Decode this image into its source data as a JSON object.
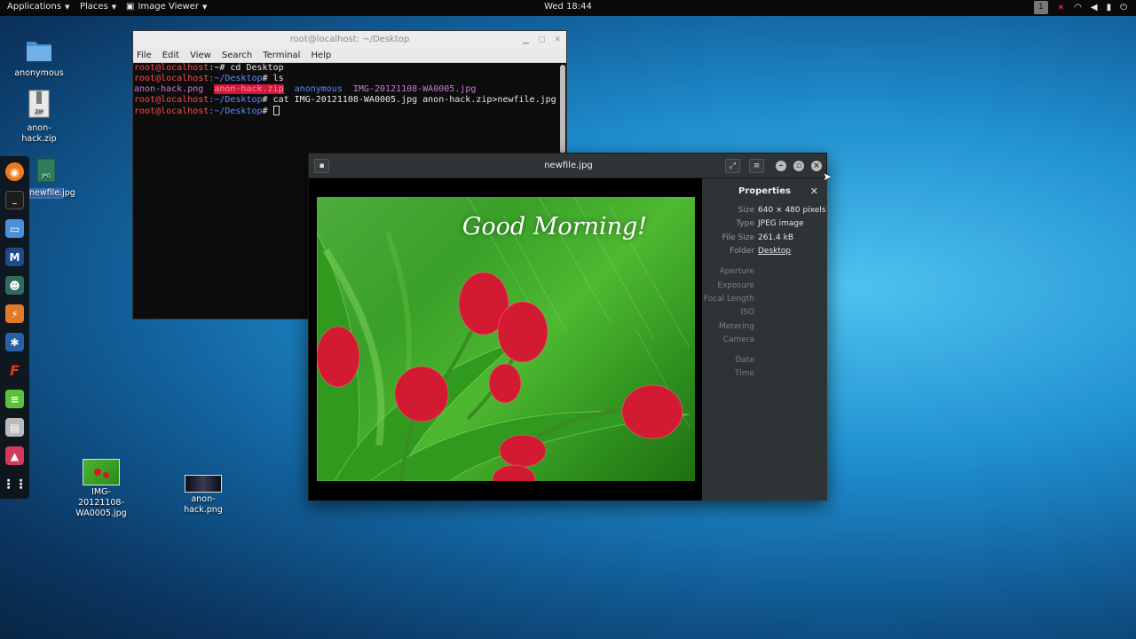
{
  "topbar": {
    "applications": "Applications",
    "places": "Places",
    "image_viewer": "Image Viewer",
    "clock": "Wed 18:44",
    "workspace": "1"
  },
  "desktop": {
    "icons": [
      {
        "label": "anonymous",
        "type": "folder"
      },
      {
        "label": "anon-hack.zip",
        "type": "zip"
      },
      {
        "label": "newfile.jpg",
        "type": "jpg"
      },
      {
        "label": "IMG-20121108-WA0005.jpg",
        "type": "image"
      },
      {
        "label": "anon-hack.png",
        "type": "image"
      }
    ],
    "zip_badge": "ZIP",
    "jpg_badge": "JPG"
  },
  "terminal": {
    "title": "root@localhost: ~/Desktop",
    "menu": [
      "File",
      "Edit",
      "View",
      "Search",
      "Terminal",
      "Help"
    ],
    "prompt_user": "root@localhost",
    "prompt_home": ":~#",
    "prompt_desktop_path": ":~/Desktop",
    "prompt_symbol": "#",
    "cmd1": " cd Desktop",
    "cmd2": " ls",
    "ls_items": [
      "anon-hack.png",
      "anon-hack.zip",
      "anonymous",
      "IMG-20121108-WA0005.jpg"
    ],
    "cmd3": " cat IMG-20121108-WA0005.jpg anon-hack.zip>newfile.jpg"
  },
  "viewer": {
    "title": "newfile.jpg",
    "caption": "Good Morning!",
    "properties": {
      "title": "Properties",
      "rows": [
        {
          "key": "Size",
          "value": "640 × 480 pixels"
        },
        {
          "key": "Type",
          "value": "JPEG image"
        },
        {
          "key": "File Size",
          "value": "261.4 kB"
        },
        {
          "key": "Folder",
          "value": "Desktop"
        }
      ],
      "empty_rows": [
        "Aperture",
        "Exposure",
        "Focal Length",
        "ISO",
        "Metering",
        "Camera"
      ],
      "date_rows": [
        "Date",
        "Time"
      ]
    }
  },
  "colors": {
    "prompt_user": "#ff4b4b",
    "prompt_path": "#5a8dff",
    "highlight": "#d1163a",
    "link": "#4a90d9"
  }
}
